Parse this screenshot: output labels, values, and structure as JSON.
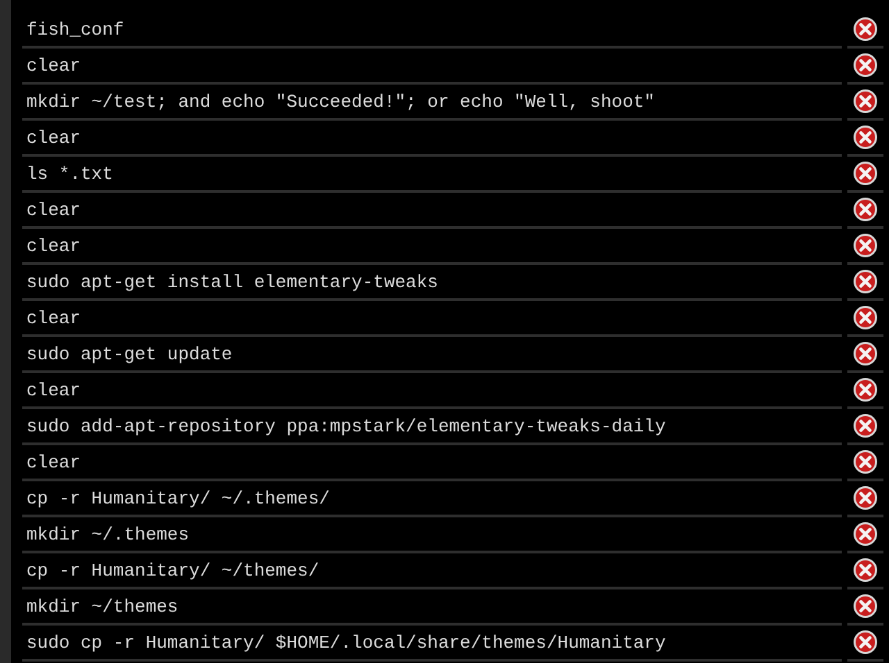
{
  "history": [
    {
      "command": "fish_conf"
    },
    {
      "command": "clear"
    },
    {
      "command": "mkdir ~/test; and echo \"Succeeded!\"; or echo \"Well, shoot\""
    },
    {
      "command": "clear"
    },
    {
      "command": "ls *.txt"
    },
    {
      "command": "clear"
    },
    {
      "command": "clear"
    },
    {
      "command": "sudo apt-get install elementary-tweaks"
    },
    {
      "command": "clear"
    },
    {
      "command": "sudo apt-get update"
    },
    {
      "command": "clear"
    },
    {
      "command": "sudo add-apt-repository ppa:mpstark/elementary-tweaks-daily"
    },
    {
      "command": "clear"
    },
    {
      "command": "cp -r Humanitary/ ~/.themes/"
    },
    {
      "command": "mkdir ~/.themes"
    },
    {
      "command": "cp -r Humanitary/ ~/themes/"
    },
    {
      "command": "mkdir ~/themes"
    },
    {
      "command": "sudo cp -r Humanitary/ $HOME/.local/share/themes/Humanitary"
    }
  ]
}
